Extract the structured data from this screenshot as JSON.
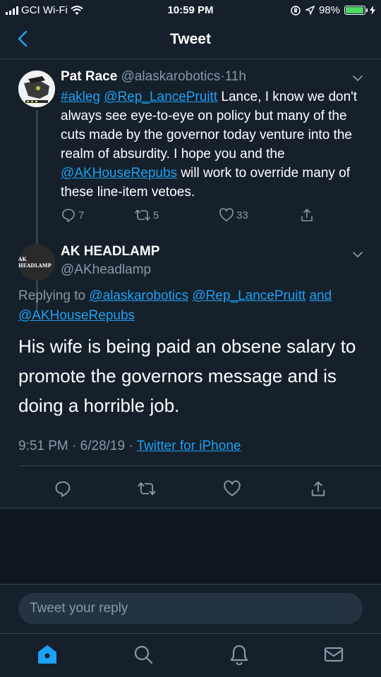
{
  "status_bar": {
    "carrier": "GCI Wi-Fi",
    "time": "10:59 PM",
    "battery": "98%",
    "battery_level": 0.98
  },
  "nav": {
    "title": "Tweet"
  },
  "parent_tweet": {
    "name": "Pat Race",
    "handle": "@alaskarobotics",
    "separator": "·",
    "age": "11h",
    "body_parts": {
      "tag1": "#akleg",
      "mention1": "@Rep_LancePruitt",
      "text1": " Lance, I know we don't always see eye-to-eye on policy but many of the cuts made by the governor today venture into the realm of absurdity. I hope you and the ",
      "mention2": "@AKHouseRepubs",
      "text2": " will work to override many of these line-item vetoes."
    },
    "replies": "7",
    "retweets": "5",
    "likes": "33"
  },
  "main_tweet": {
    "avatar_text": "AK HEADLAMP",
    "name": "AK HEADLAMP",
    "handle": "@AKheadlamp",
    "replying_prefix": "Replying to ",
    "replying_mention1": "@alaskarobotics",
    "replying_mention2": "@Rep_LancePruitt",
    "replying_and": "and",
    "replying_mention3": "@AKHouseRepubs",
    "body": "His wife is being paid an obsene salary to promote the governors message and is doing a horrible job.",
    "time": "9:51 PM",
    "date": "6/28/19",
    "dot": "·",
    "client": "Twitter for iPhone"
  },
  "reply_box": {
    "placeholder": "Tweet your reply"
  },
  "colors": {
    "background": "#15202b",
    "link": "#1da1f2",
    "secondary_text": "#8899a6",
    "divider": "#38444d"
  },
  "icons": {
    "back": "chevron-left-icon",
    "reply": "reply-icon",
    "retweet": "retweet-icon",
    "like": "heart-icon",
    "share": "share-icon",
    "home": "home-icon",
    "search": "search-icon",
    "notifications": "bell-icon",
    "messages": "mail-icon"
  }
}
